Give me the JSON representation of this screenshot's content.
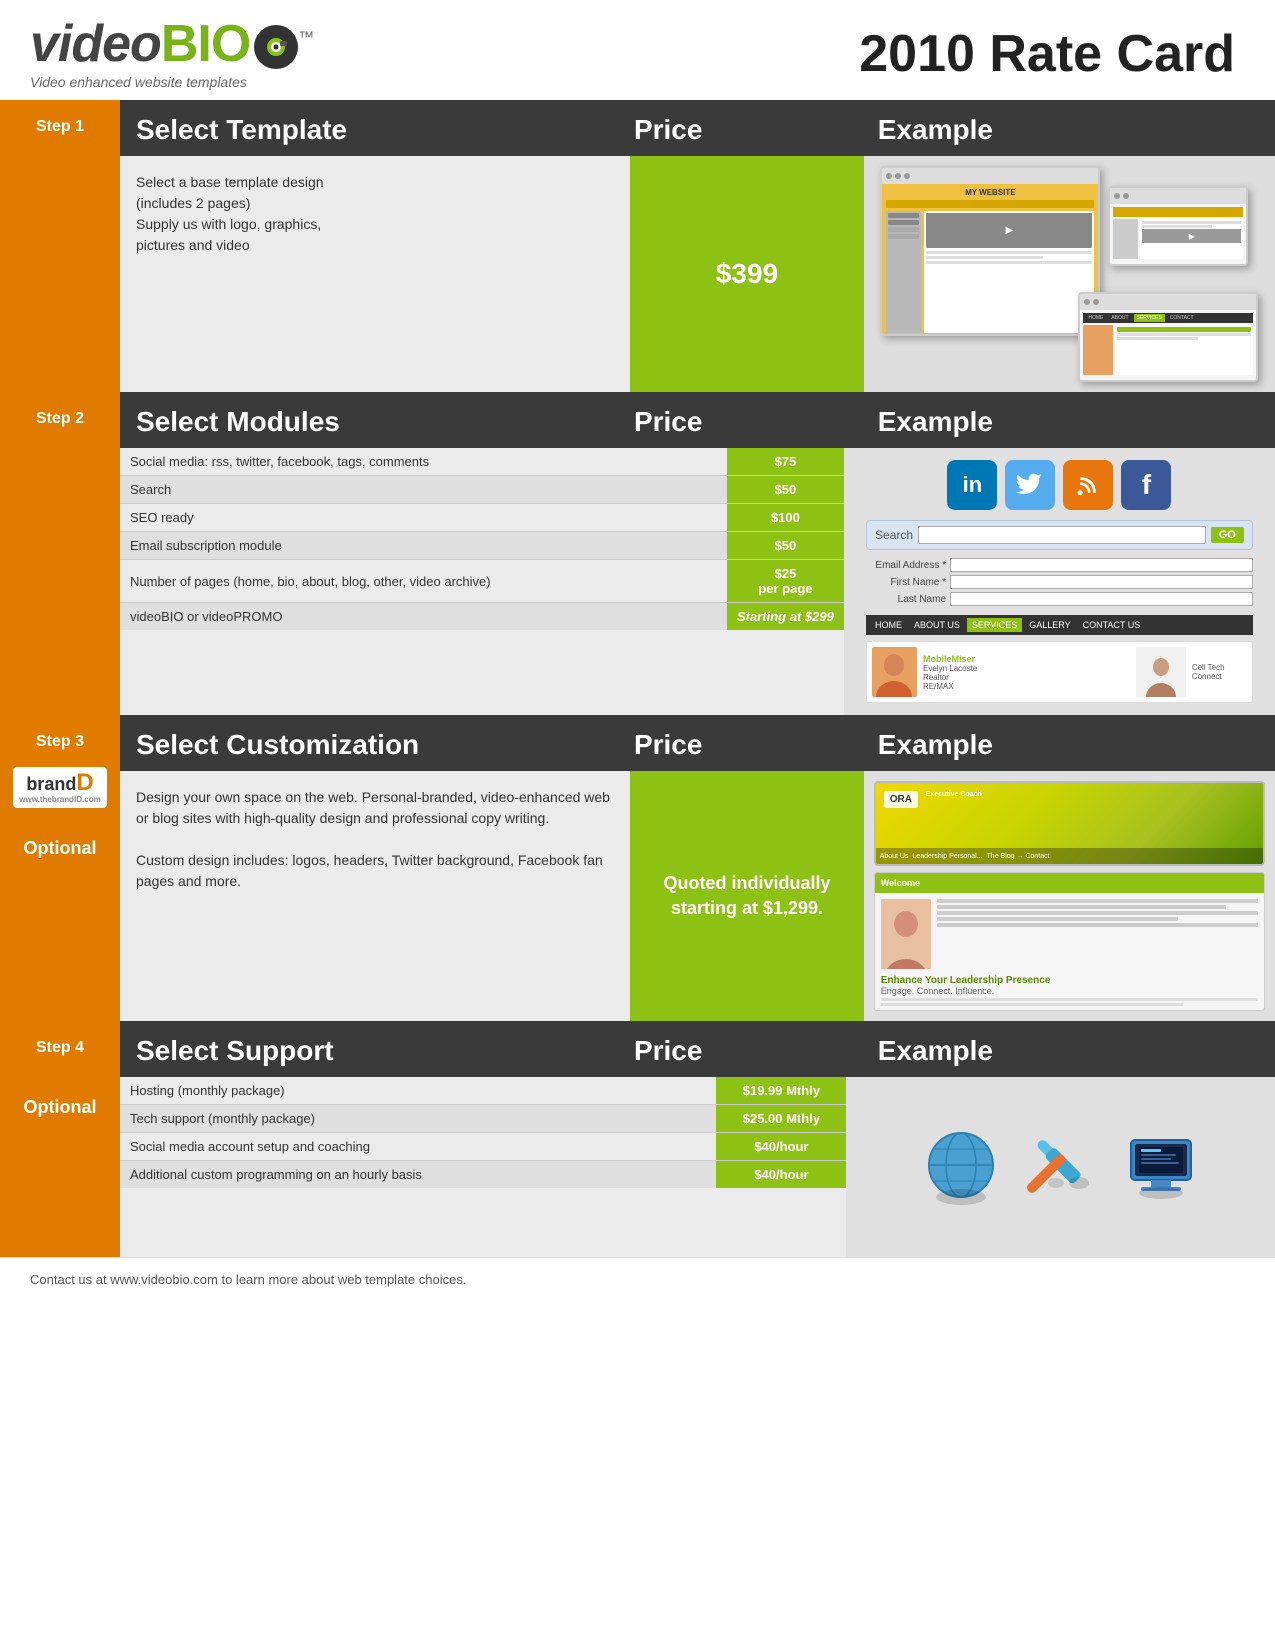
{
  "header": {
    "logo_text_video": "video",
    "logo_text_bio": "BIO",
    "logo_tm": "™",
    "tagline": "Video enhanced website templates",
    "rate_card_title": "2010 Rate Card"
  },
  "step1": {
    "step_num": "Step 1",
    "section_title": "Select Template",
    "price_header": "Price",
    "example_header": "Example",
    "description_line1": "Select a base template design",
    "description_line2": "(includes 2 pages)",
    "description_line3": "Supply us with logo, graphics,",
    "description_line4": "pictures and video",
    "price": "$399"
  },
  "step2": {
    "step_num": "Step 2",
    "section_title": "Select Modules",
    "price_header": "Price",
    "example_header": "Example",
    "rows": [
      {
        "desc": "Social media: rss, twitter, facebook, tags, comments",
        "price": "$75"
      },
      {
        "desc": "Search",
        "price": "$50"
      },
      {
        "desc": "SEO ready",
        "price": "$100"
      },
      {
        "desc": "Email subscription module",
        "price": "$50"
      },
      {
        "desc": "Number of pages (home, bio, about, blog, other, video archive)",
        "price": "$25 per page"
      },
      {
        "desc": "videoBIO or videoPROMO",
        "price": "Starting at $299"
      }
    ]
  },
  "step3": {
    "step_num": "Step 3",
    "section_title": "Select Customization",
    "price_header": "Price",
    "example_header": "Example",
    "optional_label": "Optional",
    "brand_name": "brand",
    "brand_d": "D",
    "brand_url": "www.thebrandID.com",
    "description": "Design your own space on the web. Personal-branded, video-enhanced web or blog sites with high-quality design and professional copy writing.",
    "custom_desc": "Custom design includes: logos, headers, Twitter background, Facebook fan pages and more.",
    "price": "Quoted individually starting at $1,299."
  },
  "step4": {
    "step_num": "Step 4",
    "section_title": "Select Support",
    "price_header": "Price",
    "example_header": "Example",
    "optional_label": "Optional",
    "rows": [
      {
        "desc": "Hosting (monthly package)",
        "price": "$19.99 Mthly"
      },
      {
        "desc": "Tech support (monthly package)",
        "price": "$25.00 Mthly"
      },
      {
        "desc": "Social media account setup and coaching",
        "price": "$40/hour"
      },
      {
        "desc": "Additional custom programming on an hourly basis",
        "price": "$40/hour"
      }
    ]
  },
  "footer": {
    "text": "Contact us at www.videobio.com to learn more about web template choices."
  }
}
